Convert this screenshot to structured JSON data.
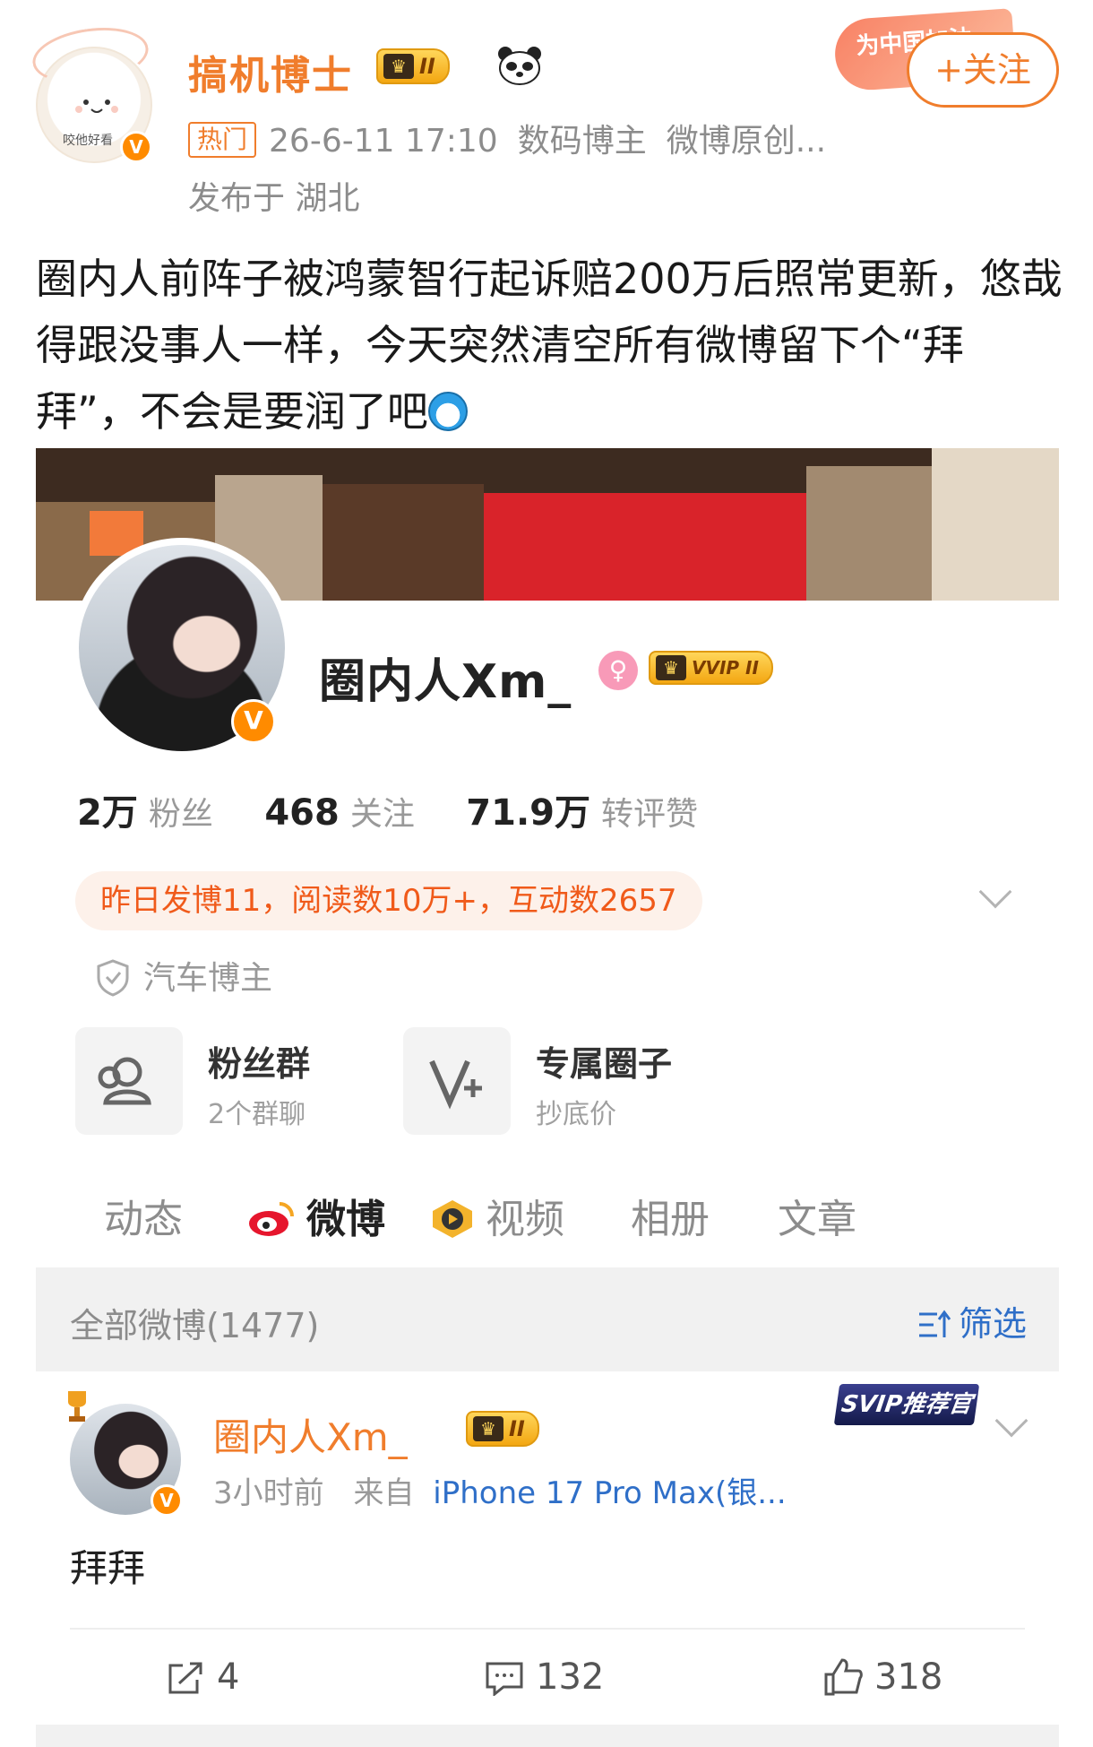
{
  "post": {
    "author": "搞机博士",
    "level_badge": "II",
    "hot_tag": "热门",
    "time": "26-6-11 17:10",
    "category": "数码博主",
    "original": "微博原创...",
    "location": "发布于 湖北",
    "avatar_caption": "咬他好看",
    "promo": "为中国加油",
    "follow_label": "+关注",
    "text": "圈内人前阵子被鸿蒙智行起诉赔200万后照常更新，悠哉得跟没事人一样，今天突然清空所有微博留下个“拜拜”，不会是要润了吧"
  },
  "profile": {
    "name": "圈内人Xm_",
    "vip_badge": "VVIP II",
    "stats": [
      {
        "value": "2万",
        "label": "粉丝"
      },
      {
        "value": "468",
        "label": "关注"
      },
      {
        "value": "71.9万",
        "label": "转评赞"
      }
    ],
    "yesterday": "昨日发博11，阅读数10万+，互动数2657",
    "certification": "汽车博主",
    "tiles": [
      {
        "title": "粉丝群",
        "subtitle": "2个群聊",
        "icon": "users-icon"
      },
      {
        "title": "专属圈子",
        "subtitle": "抄底价",
        "icon": "v-plus-icon"
      }
    ],
    "tabs": [
      "动态",
      "微博",
      "视频",
      "相册",
      "文章"
    ],
    "active_tab": "微博"
  },
  "filter": {
    "all_label": "全部微博(1477)",
    "filter_label": "筛选"
  },
  "feed_item": {
    "name": "圈内人Xm_",
    "level_badge": "II",
    "svip_label": "SVIP推荐官",
    "time": "3小时前",
    "source_prefix": "来自",
    "source": "iPhone 17 Pro Max(银...",
    "text": "拜拜",
    "reposts": "4",
    "comments": "132",
    "likes": "318"
  },
  "colors": {
    "accent": "#f07d2c",
    "link": "#2f6fc8",
    "highlight_text": "#f05a1a"
  }
}
